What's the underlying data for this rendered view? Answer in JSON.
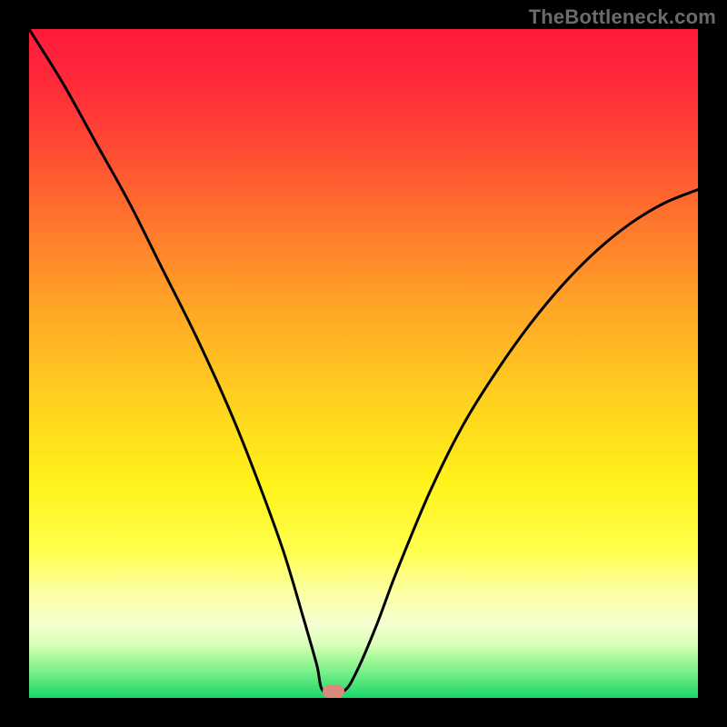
{
  "watermark": "TheBottleneck.com",
  "marker": {
    "x_pct": 45.5,
    "y_pct": 99.0
  },
  "chart_data": {
    "type": "line",
    "title": "",
    "xlabel": "",
    "ylabel": "",
    "xlim": [
      0,
      100
    ],
    "ylim": [
      0,
      100
    ],
    "series": [
      {
        "name": "bottleneck-curve",
        "x": [
          0,
          5,
          10,
          15,
          20,
          25,
          30,
          34,
          38,
          41,
          43,
          44,
          47,
          49,
          52,
          55,
          60,
          65,
          70,
          75,
          80,
          85,
          90,
          95,
          100
        ],
        "values": [
          100,
          92,
          83,
          74,
          64,
          54,
          43,
          33,
          22,
          12,
          5,
          1,
          1,
          4,
          11,
          19,
          31,
          41,
          49,
          56,
          62,
          67,
          71,
          74,
          76
        ]
      }
    ],
    "background_gradient": {
      "orientation": "vertical",
      "stops": [
        {
          "pos": 0.0,
          "color": "#ff1a3a"
        },
        {
          "pos": 0.3,
          "color": "#ff7a2c"
        },
        {
          "pos": 0.55,
          "color": "#ffcf1f"
        },
        {
          "pos": 0.78,
          "color": "#ffff4d"
        },
        {
          "pos": 0.92,
          "color": "#d8ffb8"
        },
        {
          "pos": 1.0,
          "color": "#18d66a"
        }
      ]
    },
    "annotations": [
      {
        "type": "marker",
        "x": 45.5,
        "y": 1.0,
        "color": "#d98a7a"
      }
    ]
  }
}
